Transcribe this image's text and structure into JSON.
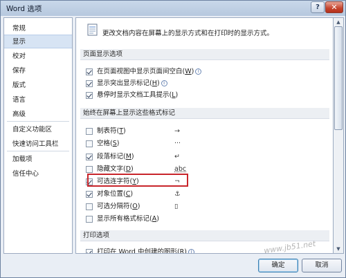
{
  "window": {
    "title": "Word 选项",
    "help_label": "?",
    "close_label": "✕"
  },
  "nav": {
    "items": [
      {
        "label": "常规"
      },
      {
        "label": "显示",
        "selected": true
      },
      {
        "label": "校对"
      },
      {
        "label": "保存"
      },
      {
        "label": "版式"
      },
      {
        "label": "语言"
      },
      {
        "label": "高级"
      },
      {
        "label": "自定义功能区"
      },
      {
        "label": "快速访问工具栏"
      },
      {
        "label": "加载项"
      },
      {
        "label": "信任中心"
      }
    ]
  },
  "content": {
    "header": "更改文档内容在屏幕上的显示方式和在打印时的显示方式。",
    "sections": {
      "page_display": "页面显示选项",
      "format_marks": "始终在屏幕上显示这些格式标记",
      "print": "打印选项"
    },
    "page_options": [
      {
        "label": "在页面视图中显示页面间空白(",
        "key": "W",
        "info": true,
        "checked": true
      },
      {
        "label": "显示突出显示标记(",
        "key": "H",
        "info": true,
        "checked": true
      },
      {
        "label": "悬停时显示文档工具提示(",
        "key": "L",
        "info": false,
        "checked": true
      }
    ],
    "mark_options": [
      {
        "label": "制表符(",
        "key": "T",
        "symbol": "→",
        "checked": false
      },
      {
        "label": "空格(",
        "key": "S",
        "symbol": "···",
        "checked": false
      },
      {
        "label": "段落标记(",
        "key": "M",
        "symbol": "↵",
        "checked": true
      },
      {
        "label": "隐藏文字(",
        "key": "D",
        "symbol": "abc",
        "checked": false
      },
      {
        "label": "可选连字符(",
        "key": "Y",
        "symbol": "¬",
        "checked": true
      },
      {
        "label": "对象位置(",
        "key": "C",
        "symbol": "⚓",
        "checked": true
      },
      {
        "label": "可选分隔符(",
        "key": "O",
        "symbol": "▯",
        "checked": false
      },
      {
        "label": "显示所有格式标记(",
        "key": "A",
        "symbol": "",
        "checked": false
      }
    ],
    "print_options": [
      {
        "label": "打印在 Word 中创建的图形(",
        "key": "R",
        "info": true,
        "checked": true
      }
    ]
  },
  "footer": {
    "ok_label": "确定",
    "cancel_label": "取消"
  },
  "watermark": "www.jb51.net",
  "colors": {
    "highlight": "#c8242a",
    "selected_nav": "#d7e4f4"
  }
}
